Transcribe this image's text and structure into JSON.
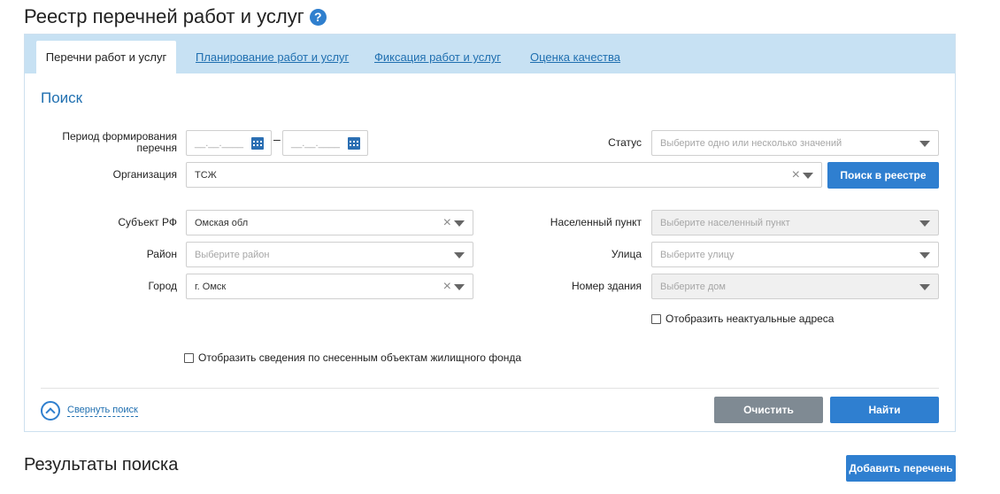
{
  "header": {
    "title": "Реестр перечней работ и услуг",
    "help_glyph": "?"
  },
  "tabs": [
    {
      "label": "Перечни работ и услуг",
      "active": true
    },
    {
      "label": "Планирование работ и услуг",
      "active": false
    },
    {
      "label": "Фиксация работ и услуг",
      "active": false
    },
    {
      "label": "Оценка качества",
      "active": false
    }
  ],
  "search": {
    "title": "Поиск",
    "period": {
      "label": "Период формирования перечня",
      "from_placeholder": "__.__.____",
      "to_placeholder": "__.__.____",
      "separator": "–"
    },
    "status": {
      "label": "Статус",
      "placeholder": "Выберите одно или несколько значений"
    },
    "organization": {
      "label": "Организация",
      "value": "ТСЖ"
    },
    "registry_search_button": "Поиск в реестре",
    "region": {
      "label": "Субъект РФ",
      "value": "Омская обл"
    },
    "locality": {
      "label": "Населенный пункт",
      "placeholder": "Выберите населенный пункт"
    },
    "district": {
      "label": "Район",
      "placeholder": "Выберите район"
    },
    "street": {
      "label": "Улица",
      "placeholder": "Выберите улицу"
    },
    "city": {
      "label": "Город",
      "value": "г. Омск"
    },
    "building": {
      "label": "Номер здания",
      "placeholder": "Выберите дом"
    },
    "show_outdated_addresses": "Отобразить неактуальные адреса",
    "show_demolished": "Отобразить сведения по снесенным объектам жилищного фонда",
    "collapse_label": "Свернуть поиск",
    "clear_button": "Очистить",
    "find_button": "Найти"
  },
  "results": {
    "title": "Результаты поиска",
    "add_button": "Добавить перечень"
  },
  "colors": {
    "accent": "#2f7fd0",
    "tab_bar": "#c7e1f3",
    "link": "#1f6fb0",
    "gray_button": "#7f8a93"
  }
}
